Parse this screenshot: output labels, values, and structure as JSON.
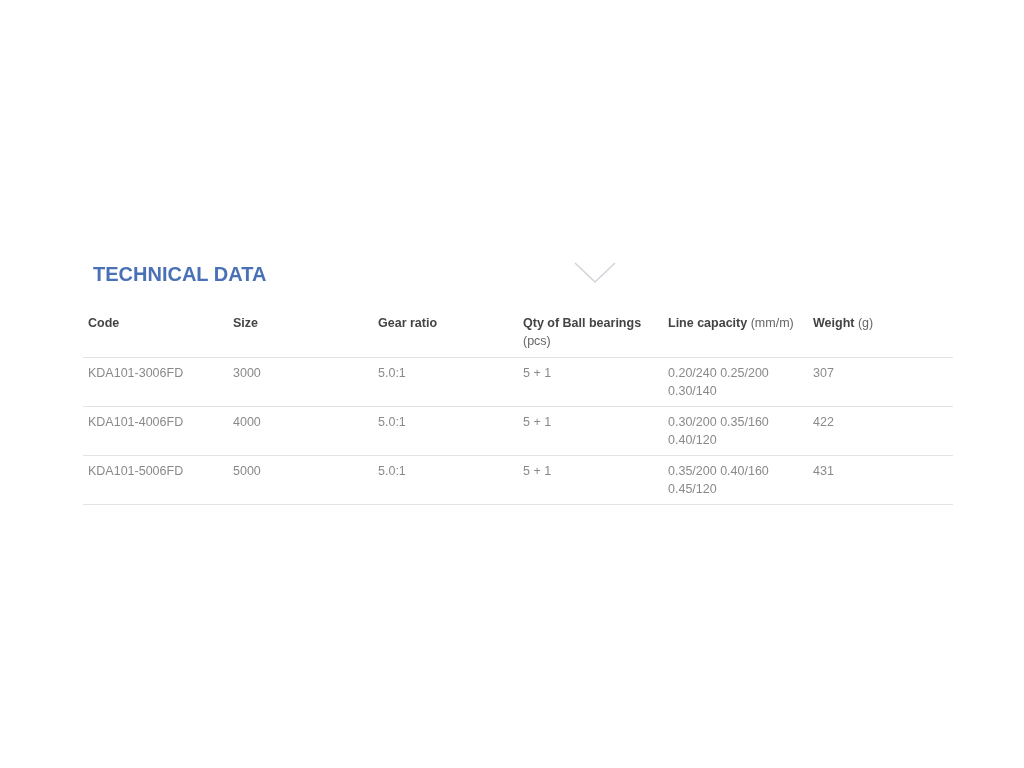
{
  "section": {
    "title": "TECHNICAL DATA"
  },
  "table": {
    "columns": [
      "Code",
      "Size",
      "Gear ratio",
      "**Qty of Ball bearings** (pcs)",
      "**Line capacity** (mm/m)",
      "**Weight** (g)"
    ],
    "rows": [
      [
        "KDA101-3006FD",
        "3000",
        "5.0:1",
        "5 + 1",
        "0.20/240 0.25/200 0.30/140",
        "307"
      ],
      [
        "KDA101-4006FD",
        "4000",
        "5.0:1",
        "5 + 1",
        "0.30/200 0.35/160 0.40/120",
        "422"
      ],
      [
        "KDA101-5006FD",
        "5000",
        "5.0:1",
        "5 + 1",
        "0.35/200 0.40/160 0.45/120",
        "431"
      ]
    ]
  }
}
